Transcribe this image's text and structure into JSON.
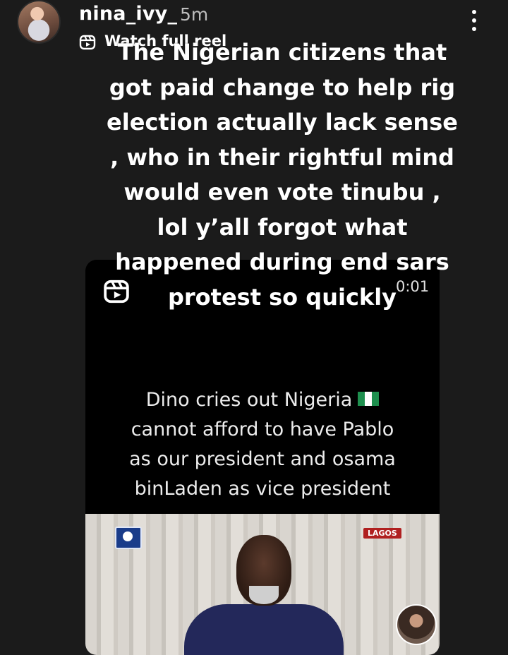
{
  "header": {
    "username": "nina_ivy_",
    "timestamp": "5m",
    "watch_label": "Watch full reel"
  },
  "video": {
    "time": "0:01",
    "caption_lines": [
      "Dino cries out Nigeria",
      "cannot afford to have Pablo",
      "as our president and osama",
      "binLaden as vice president"
    ],
    "location_tag": "LAGOS"
  },
  "story_text": "The Nigerian citizens that got paid change to help rig election actually lack sense , who in their rightful mind would even vote tinubu , lol y’all forgot what happened during end sars protest so quickly",
  "colors": {
    "background": "#1b1b1b",
    "text": "#ffffff",
    "timestamp": "#bdbdbd",
    "flag_green": "#1e8f4e"
  },
  "icons": [
    "reel-icon",
    "more-options-icon",
    "nigeria-flag-icon",
    "channel-logo-icon"
  ]
}
